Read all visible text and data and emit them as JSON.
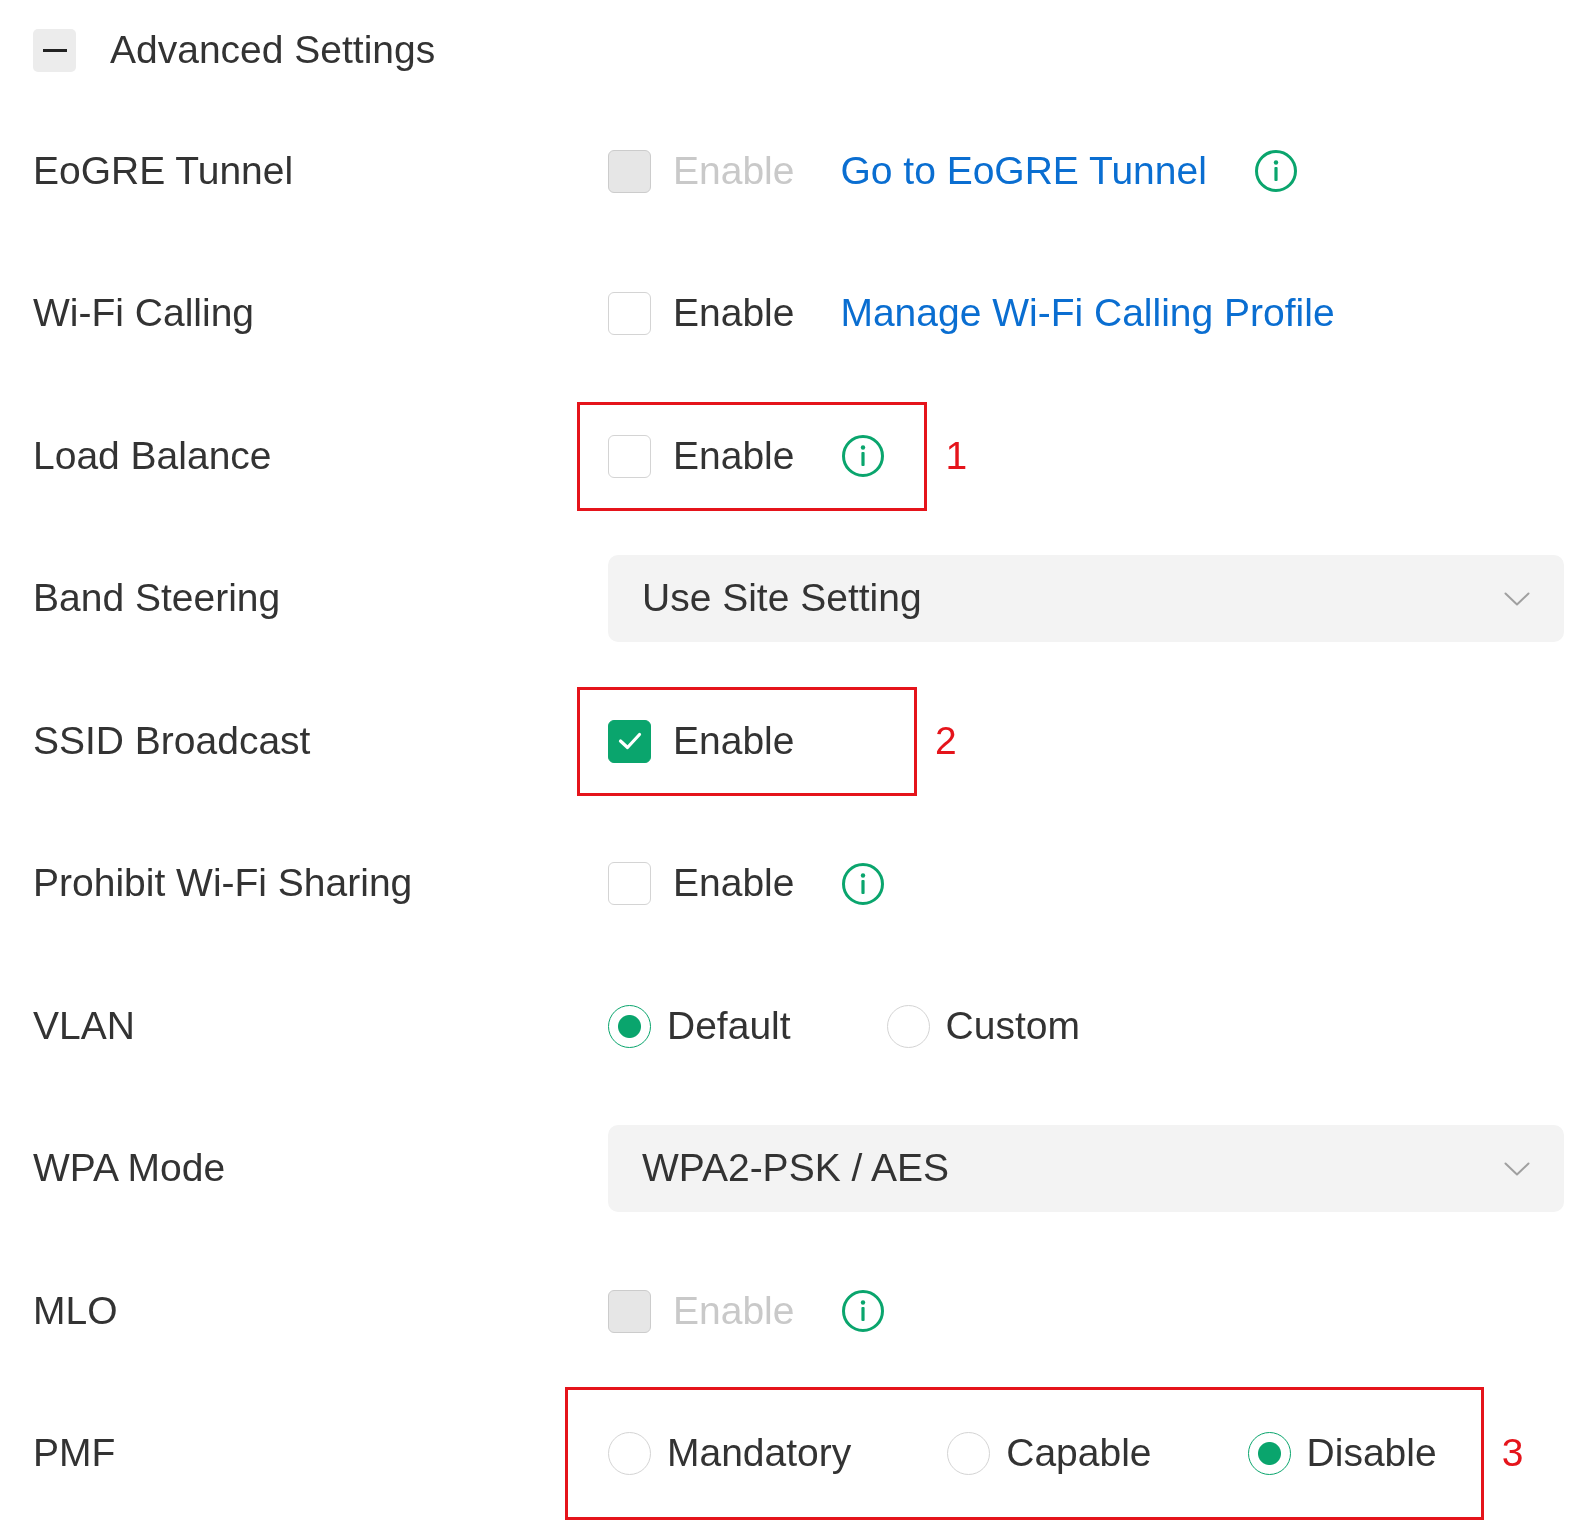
{
  "section": {
    "title": "Advanced Settings",
    "expanded": true
  },
  "rows": [
    {
      "label": "EoGRE Tunnel",
      "kind": "checkbox",
      "option": {
        "label": "Enable",
        "checked": false,
        "disabled": true
      },
      "link": "Go to EoGRE Tunnel",
      "info": true
    },
    {
      "label": "Wi-Fi Calling",
      "kind": "checkbox",
      "option": {
        "label": "Enable",
        "checked": false,
        "disabled": false
      },
      "link": "Manage Wi-Fi Calling Profile",
      "info": false
    },
    {
      "label": "Load Balance",
      "kind": "checkbox",
      "option": {
        "label": "Enable",
        "checked": false,
        "disabled": false
      },
      "info": true,
      "annotation": "1"
    },
    {
      "label": "Band Steering",
      "kind": "select",
      "value": "Use Site Setting"
    },
    {
      "label": "SSID Broadcast",
      "kind": "checkbox",
      "option": {
        "label": "Enable",
        "checked": true,
        "disabled": false
      },
      "info": false,
      "annotation": "2"
    },
    {
      "label": "Prohibit Wi-Fi Sharing",
      "kind": "checkbox",
      "option": {
        "label": "Enable",
        "checked": false,
        "disabled": false
      },
      "info": true
    },
    {
      "label": "VLAN",
      "kind": "radio",
      "options": [
        {
          "label": "Default",
          "selected": true
        },
        {
          "label": "Custom",
          "selected": false
        }
      ]
    },
    {
      "label": "WPA Mode",
      "kind": "select",
      "value": "WPA2-PSK / AES"
    },
    {
      "label": "MLO",
      "kind": "checkbox",
      "option": {
        "label": "Enable",
        "checked": false,
        "disabled": true
      },
      "info": true
    },
    {
      "label": "PMF",
      "kind": "radio",
      "options": [
        {
          "label": "Mandatory",
          "selected": false
        },
        {
          "label": "Capable",
          "selected": false
        },
        {
          "label": "Disable",
          "selected": true
        }
      ],
      "annotation": "3"
    }
  ]
}
